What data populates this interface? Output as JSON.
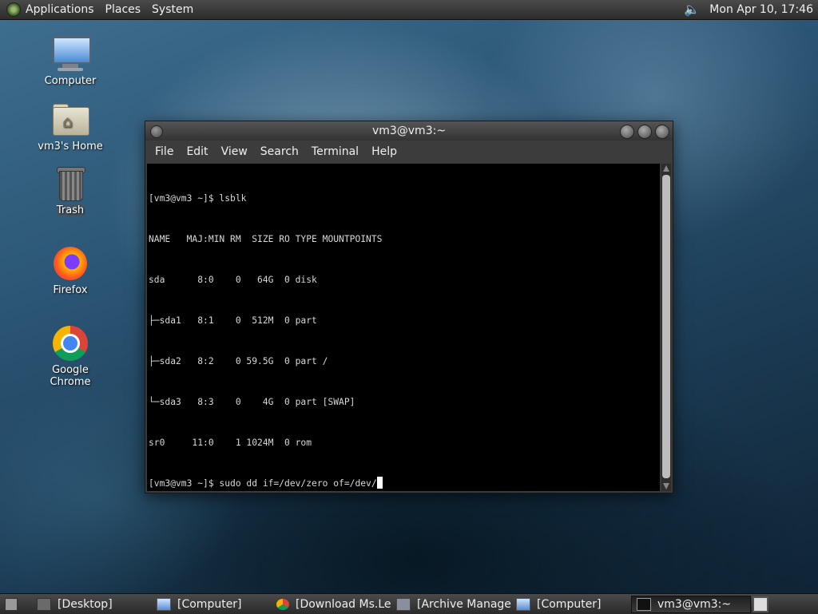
{
  "top_panel": {
    "menus": [
      "Applications",
      "Places",
      "System"
    ],
    "clock": "Mon Apr 10, 17:46",
    "icons": [
      "distro-logo-icon",
      "volume-icon"
    ]
  },
  "desktop_icons": [
    {
      "label": "Computer",
      "icon": "computer-icon"
    },
    {
      "label": "vm3's Home",
      "icon": "home-folder-icon"
    },
    {
      "label": "Trash",
      "icon": "trash-icon"
    },
    {
      "label": "Firefox",
      "icon": "firefox-icon"
    },
    {
      "label": "Google Chrome",
      "icon": "chrome-icon"
    }
  ],
  "terminal": {
    "title": "vm3@vm3:~",
    "menu": [
      "File",
      "Edit",
      "View",
      "Search",
      "Terminal",
      "Help"
    ],
    "lines": [
      "[vm3@vm3 ~]$ lsblk",
      "NAME   MAJ:MIN RM  SIZE RO TYPE MOUNTPOINTS",
      "sda      8:0    0   64G  0 disk",
      "├─sda1   8:1    0  512M  0 part",
      "├─sda2   8:2    0 59.5G  0 part /",
      "└─sda3   8:3    0    4G  0 part [SWAP]",
      "sr0     11:0    1 1024M  0 rom"
    ],
    "prompt_line": "[vm3@vm3 ~]$ sudo dd if=/dev/zero of=/dev/"
  },
  "taskbar": {
    "tasks": [
      {
        "label": "[Desktop]",
        "icon": "desktop-icon"
      },
      {
        "label": "[Computer]",
        "icon": "computer-icon"
      },
      {
        "label": "[Download Ms.Le...",
        "icon": "chrome-icon"
      },
      {
        "label": "[Archive Manager]",
        "icon": "archive-icon"
      },
      {
        "label": "[Computer]",
        "icon": "computer-icon"
      },
      {
        "label": "vm3@vm3:~",
        "icon": "terminal-icon",
        "active": true
      }
    ]
  }
}
